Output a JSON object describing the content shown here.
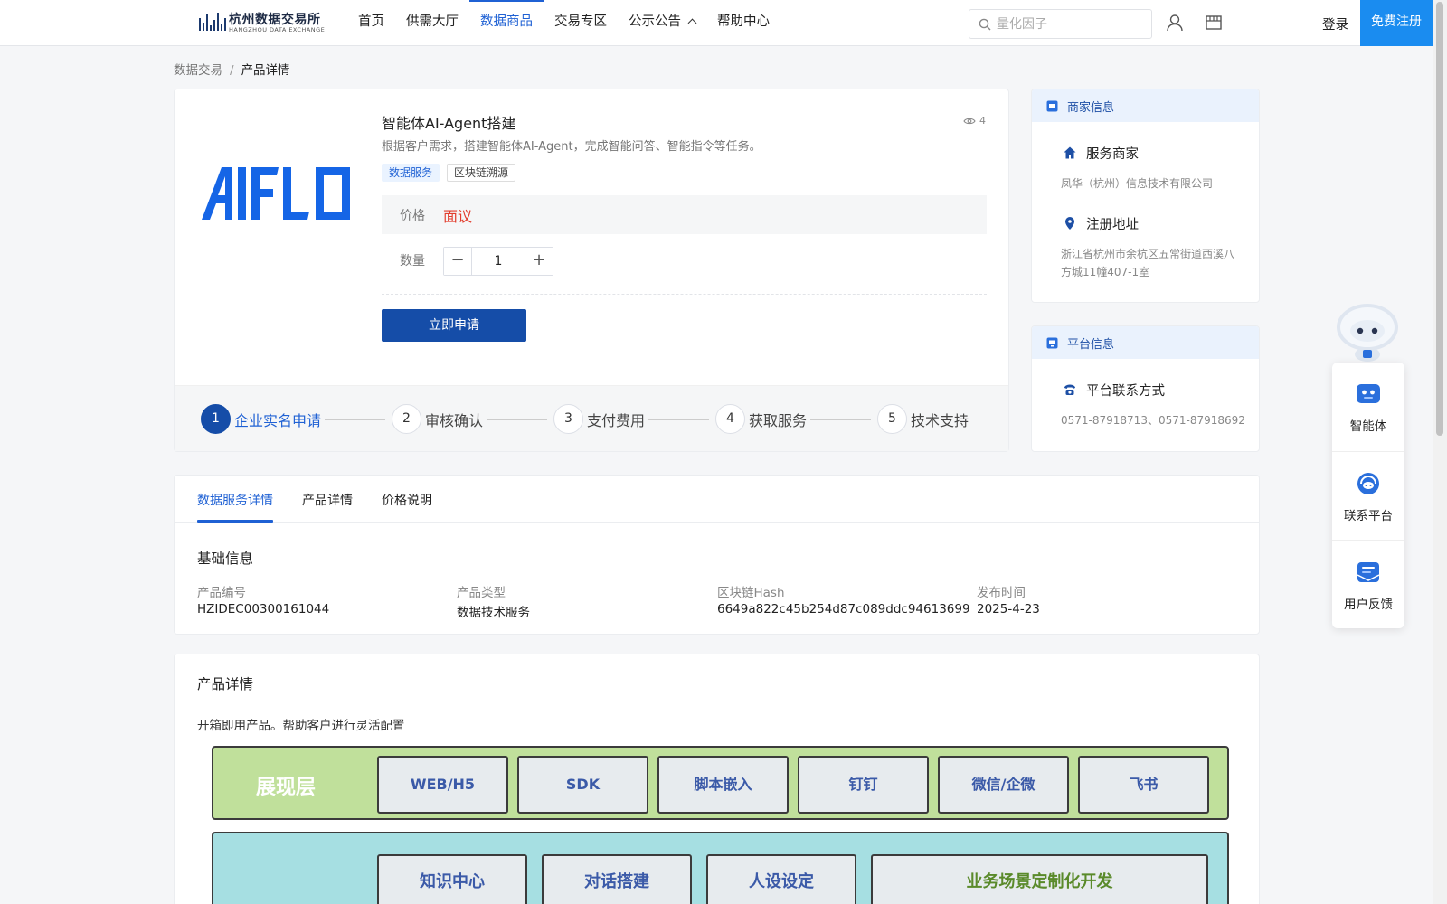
{
  "header": {
    "logo_cn": "杭州数据交易所",
    "logo_en": "HANGZHOU DATA EXCHANGE",
    "nav": [
      {
        "label": "首页"
      },
      {
        "label": "供需大厅"
      },
      {
        "label": "数据商品",
        "active": true
      },
      {
        "label": "交易专区"
      },
      {
        "label": "公示公告"
      },
      {
        "label": "帮助中心"
      }
    ],
    "search_placeholder": "量化因子",
    "login": "登录",
    "register": "免费注册"
  },
  "breadcrumb": {
    "parent": "数据交易",
    "separator": "/",
    "current": "产品详情"
  },
  "product": {
    "logo_text": "AIFLO",
    "title": "智能体AI-Agent搭建",
    "views": "4",
    "description": "根据客户需求，搭建智能体AI-Agent，完成智能问答、智能指令等任务。",
    "tags": [
      "数据服务",
      "区块链溯源"
    ],
    "price_label": "价格",
    "price_value": "面议",
    "qty_label": "数量",
    "qty_value": "1",
    "qty_minus": "−",
    "qty_plus": "+",
    "apply_button": "立即申请",
    "steps": [
      {
        "num": "1",
        "label": "企业实名申请"
      },
      {
        "num": "2",
        "label": "审核确认"
      },
      {
        "num": "3",
        "label": "支付费用"
      },
      {
        "num": "4",
        "label": "获取服务"
      },
      {
        "num": "5",
        "label": "技术支持"
      }
    ]
  },
  "merchant": {
    "title": "商家信息",
    "service_label": "服务商家",
    "service_value": "凤华（杭州）信息技术有限公司",
    "address_label": "注册地址",
    "address_value": "浙江省杭州市余杭区五常街道西溪八方城11幢407-1室"
  },
  "platform": {
    "title": "平台信息",
    "contact_label": "平台联系方式",
    "contact_value": "0571-87918713、0571-87918692"
  },
  "tabs": [
    {
      "label": "数据服务详情",
      "active": true
    },
    {
      "label": "产品详情"
    },
    {
      "label": "价格说明"
    }
  ],
  "basic_info": {
    "title": "基础信息",
    "fields": [
      {
        "label": "产品编号",
        "value": "HZIDEC00300161044"
      },
      {
        "label": "产品类型",
        "value": "数据技术服务"
      },
      {
        "label": "区块链Hash",
        "value": "6649a822c45b254d87c089ddc94613699a…"
      },
      {
        "label": "发布时间",
        "value": "2025-4-23"
      }
    ]
  },
  "detail": {
    "title": "产品详情",
    "subtitle": "开箱即用产品。帮助客户进行灵活配置",
    "layer1_title": "展现层",
    "layer1_items": [
      "WEB/H5",
      "SDK",
      "脚本嵌入",
      "钉钉",
      "微信/企微",
      "飞书"
    ],
    "layer2_items": [
      "知识中心",
      "对话搭建",
      "人设设定",
      "业务场景定制化开发"
    ]
  },
  "float_menu": [
    {
      "label": "智能体",
      "icon": "robot-icon"
    },
    {
      "label": "联系平台",
      "icon": "headset-icon"
    },
    {
      "label": "用户反馈",
      "icon": "feedback-icon"
    }
  ],
  "colors": {
    "brand": "#1f61d4",
    "primary_button": "#154da8",
    "register": "#1a8cf0",
    "price": "#e23c2c",
    "layer1_bg": "#c0e09b",
    "layer2_bg": "#a6dfe2"
  }
}
